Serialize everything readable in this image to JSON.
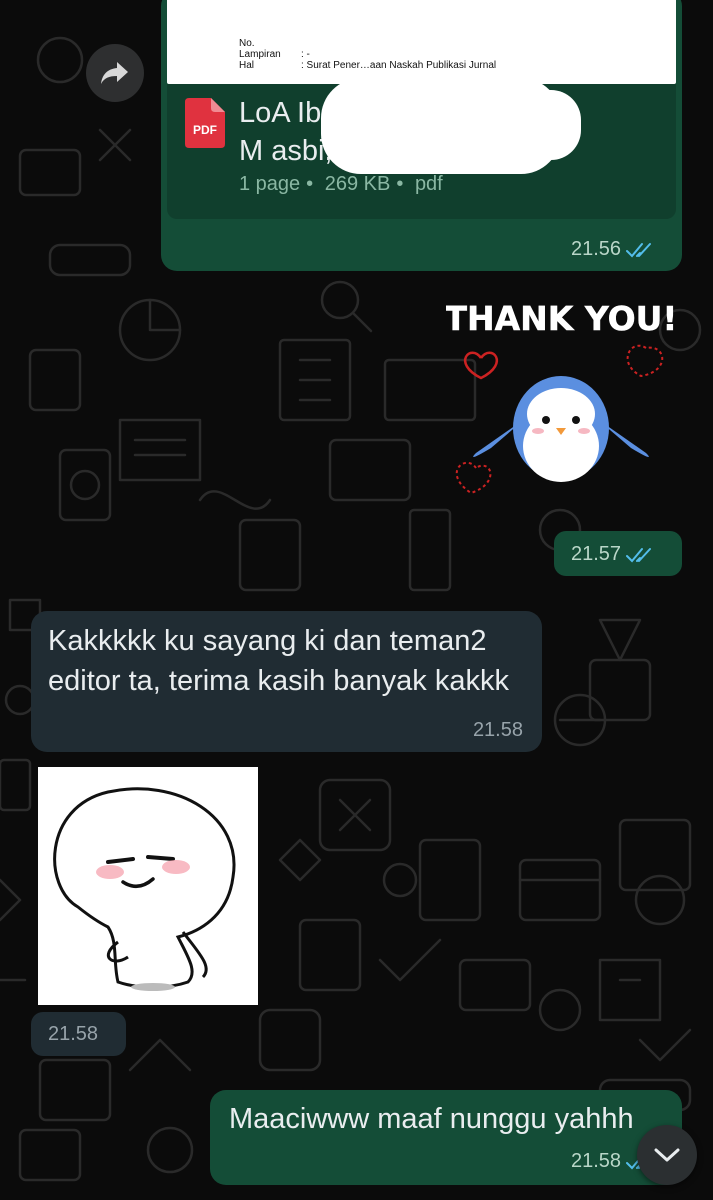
{
  "document_message": {
    "preview_lines": [
      {
        "label": "No.",
        "value": ""
      },
      {
        "label": "Lampiran",
        "value": ": -"
      },
      {
        "label": "Hal",
        "value": ": Surat Pener…aan Naskah Publikasi Jurnal"
      }
    ],
    "file_icon_label": "PDF",
    "file_name_line1": "LoA Ib",
    "file_name_line2": "M                                        asbi, S…",
    "meta": {
      "pages": "1 page",
      "size": "269 KB",
      "type": "pdf",
      "sep": "•"
    },
    "time": "21.56"
  },
  "sticker_thank_you": {
    "text": "THANK YOU!",
    "time": "21.57"
  },
  "incoming_text": {
    "text": "Kakkkkk ku sayang ki dan teman2 editor ta, terima kasih banyak kakkk",
    "time": "21.58"
  },
  "incoming_sticker": {
    "time": "21.58"
  },
  "outgoing_text": {
    "text": "Maaciwww maaf nunggu yahhh",
    "time": "21.58"
  },
  "colors": {
    "outgoing_bubble": "#144d37",
    "incoming_bubble": "#202c33",
    "read_ticks": "#53bdeb",
    "background": "#0b0b0b"
  },
  "icons": {
    "forward": "forward-arrow-icon",
    "pdf": "pdf-file-icon",
    "ticks": "double-check-icon",
    "scroll": "chevron-down-icon"
  }
}
